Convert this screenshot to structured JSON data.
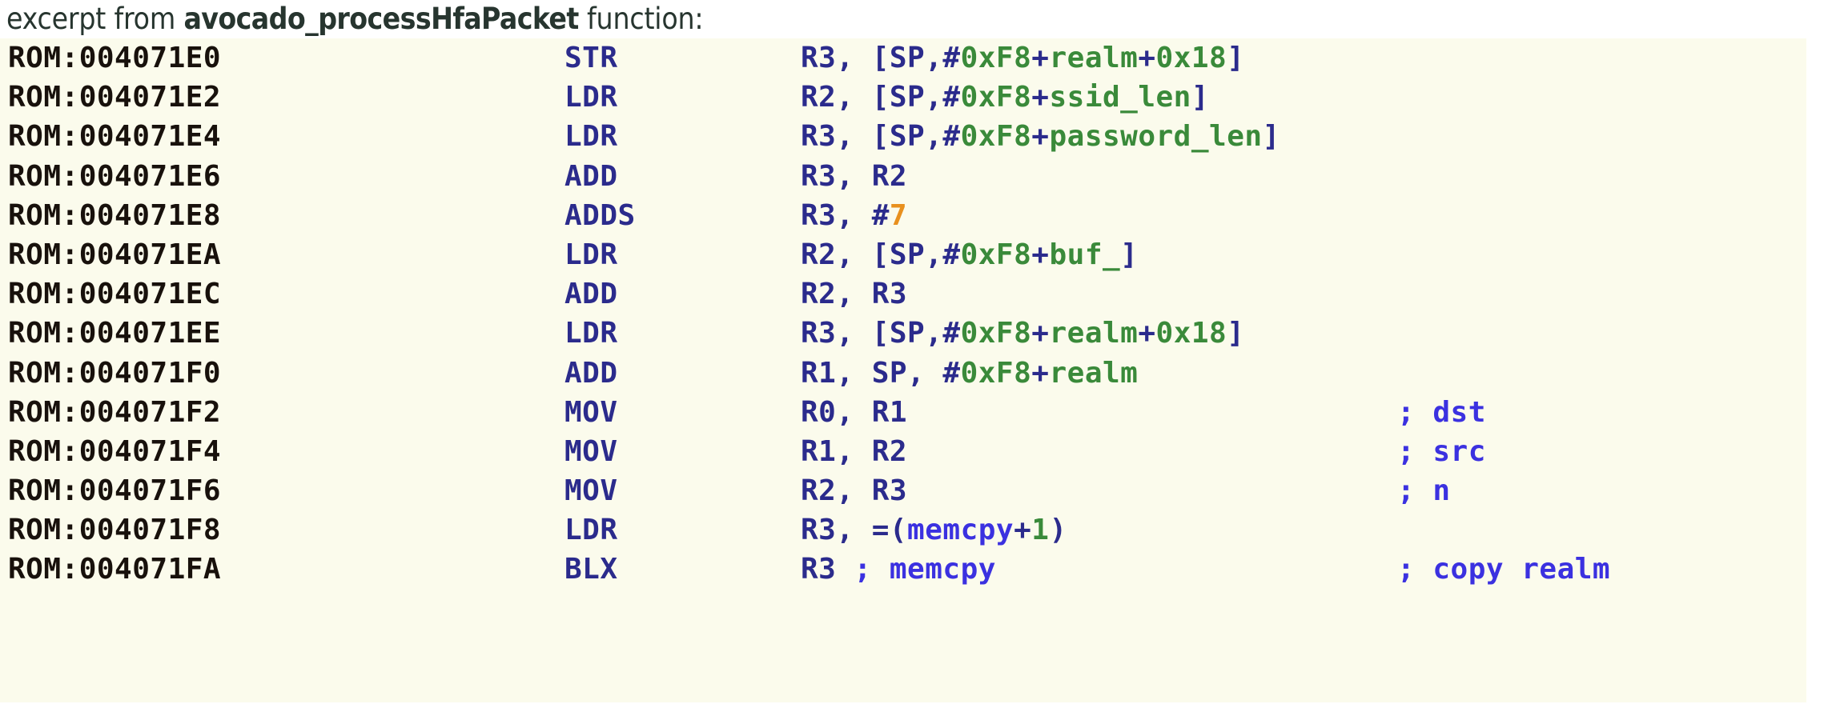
{
  "caption": {
    "lead": "excerpt from ",
    "function_name": "avocado_processHfaPacket",
    "tail": " function:"
  },
  "colors": {
    "code_background": "#fbfbec",
    "page_background": "#ffffff",
    "caption_text": "#27352f",
    "address": "#18110c",
    "mnemonic": "#2b2b8c",
    "register": "#2b2b8c",
    "symbol_green": "#3a8a3a",
    "immediate_orange": "#e8901e",
    "name_blue": "#3b31e0",
    "comment_blue": "#3b31e0"
  },
  "disassembly": {
    "segment": "ROM",
    "lines": [
      {
        "address": "ROM:004071E0",
        "mnemonic": "STR",
        "comment": "",
        "operand_tokens": [
          {
            "text": "R3, [SP,#",
            "kind": "reg"
          },
          {
            "text": "0xF8",
            "kind": "sym"
          },
          {
            "text": "+",
            "kind": "reg"
          },
          {
            "text": "realm",
            "kind": "sym"
          },
          {
            "text": "+",
            "kind": "reg"
          },
          {
            "text": "0x18",
            "kind": "sym"
          },
          {
            "text": "]",
            "kind": "reg"
          }
        ]
      },
      {
        "address": "ROM:004071E2",
        "mnemonic": "LDR",
        "comment": "",
        "operand_tokens": [
          {
            "text": "R2, [SP,#",
            "kind": "reg"
          },
          {
            "text": "0xF8",
            "kind": "sym"
          },
          {
            "text": "+",
            "kind": "reg"
          },
          {
            "text": "ssid_len",
            "kind": "sym"
          },
          {
            "text": "]",
            "kind": "reg"
          }
        ]
      },
      {
        "address": "ROM:004071E4",
        "mnemonic": "LDR",
        "comment": "",
        "operand_tokens": [
          {
            "text": "R3, [SP,#",
            "kind": "reg"
          },
          {
            "text": "0xF8",
            "kind": "sym"
          },
          {
            "text": "+",
            "kind": "reg"
          },
          {
            "text": "password_len",
            "kind": "sym"
          },
          {
            "text": "]",
            "kind": "reg"
          }
        ]
      },
      {
        "address": "ROM:004071E6",
        "mnemonic": "ADD",
        "comment": "",
        "operand_tokens": [
          {
            "text": "R3, R2",
            "kind": "reg"
          }
        ]
      },
      {
        "address": "ROM:004071E8",
        "mnemonic": "ADDS",
        "comment": "",
        "operand_tokens": [
          {
            "text": "R3, #",
            "kind": "reg"
          },
          {
            "text": "7",
            "kind": "num"
          }
        ]
      },
      {
        "address": "ROM:004071EA",
        "mnemonic": "LDR",
        "comment": "",
        "operand_tokens": [
          {
            "text": "R2, [SP,#",
            "kind": "reg"
          },
          {
            "text": "0xF8",
            "kind": "sym"
          },
          {
            "text": "+",
            "kind": "reg"
          },
          {
            "text": "buf_",
            "kind": "sym"
          },
          {
            "text": "]",
            "kind": "reg"
          }
        ]
      },
      {
        "address": "ROM:004071EC",
        "mnemonic": "ADD",
        "comment": "",
        "operand_tokens": [
          {
            "text": "R2, R3",
            "kind": "reg"
          }
        ]
      },
      {
        "address": "ROM:004071EE",
        "mnemonic": "LDR",
        "comment": "",
        "operand_tokens": [
          {
            "text": "R3, [SP,#",
            "kind": "reg"
          },
          {
            "text": "0xF8",
            "kind": "sym"
          },
          {
            "text": "+",
            "kind": "reg"
          },
          {
            "text": "realm",
            "kind": "sym"
          },
          {
            "text": "+",
            "kind": "reg"
          },
          {
            "text": "0x18",
            "kind": "sym"
          },
          {
            "text": "]",
            "kind": "reg"
          }
        ]
      },
      {
        "address": "ROM:004071F0",
        "mnemonic": "ADD",
        "comment": "",
        "operand_tokens": [
          {
            "text": "R1, SP, #",
            "kind": "reg"
          },
          {
            "text": "0xF8",
            "kind": "sym"
          },
          {
            "text": "+",
            "kind": "reg"
          },
          {
            "text": "realm",
            "kind": "sym"
          }
        ]
      },
      {
        "address": "ROM:004071F2",
        "mnemonic": "MOV",
        "comment": "; dst",
        "operand_tokens": [
          {
            "text": "R0, R1",
            "kind": "reg"
          }
        ]
      },
      {
        "address": "ROM:004071F4",
        "mnemonic": "MOV",
        "comment": "; src",
        "operand_tokens": [
          {
            "text": "R1, R2",
            "kind": "reg"
          }
        ]
      },
      {
        "address": "ROM:004071F6",
        "mnemonic": "MOV",
        "comment": "; n",
        "operand_tokens": [
          {
            "text": "R2, R3",
            "kind": "reg"
          }
        ]
      },
      {
        "address": "ROM:004071F8",
        "mnemonic": "LDR",
        "comment": "",
        "operand_tokens": [
          {
            "text": "R3, =(",
            "kind": "reg"
          },
          {
            "text": "memcpy",
            "kind": "name"
          },
          {
            "text": "+",
            "kind": "reg"
          },
          {
            "text": "1",
            "kind": "sym"
          },
          {
            "text": ")",
            "kind": "reg"
          }
        ]
      },
      {
        "address": "ROM:004071FA",
        "mnemonic": "BLX",
        "comment": "; copy realm",
        "operand_tokens": [
          {
            "text": "R3 ",
            "kind": "reg"
          },
          {
            "text": "; memcpy",
            "kind": "cmt"
          }
        ]
      }
    ]
  }
}
